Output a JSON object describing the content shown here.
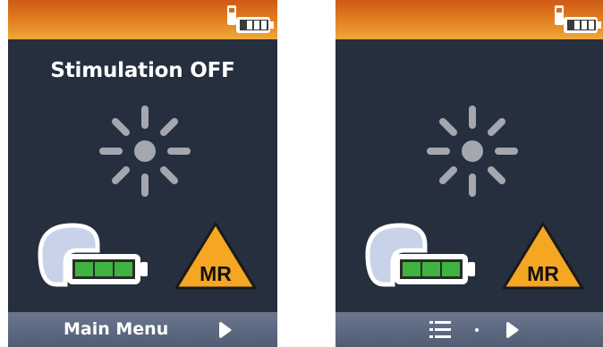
{
  "left_screen": {
    "title": "Stimulation OFF",
    "bottom_bar": {
      "label": "Main Menu"
    }
  },
  "right_screen": {
    "bottom_bar": {}
  },
  "mr_label": "MR",
  "icons": {
    "status": "remote-battery-icon",
    "loading": "spinner-icon",
    "implant": "implant-battery-icon",
    "warning": "mr-conditional-warning-icon",
    "menu": "list-icon",
    "next": "next-arrow-icon"
  },
  "colors": {
    "top_bar": "#e07a1e",
    "screen_bg": "#262f3e",
    "bottom_bar": "#5e6a81",
    "battery_fill": "#3fb33f",
    "warning_fill": "#f5a623"
  },
  "implant_battery_level": 1.0
}
